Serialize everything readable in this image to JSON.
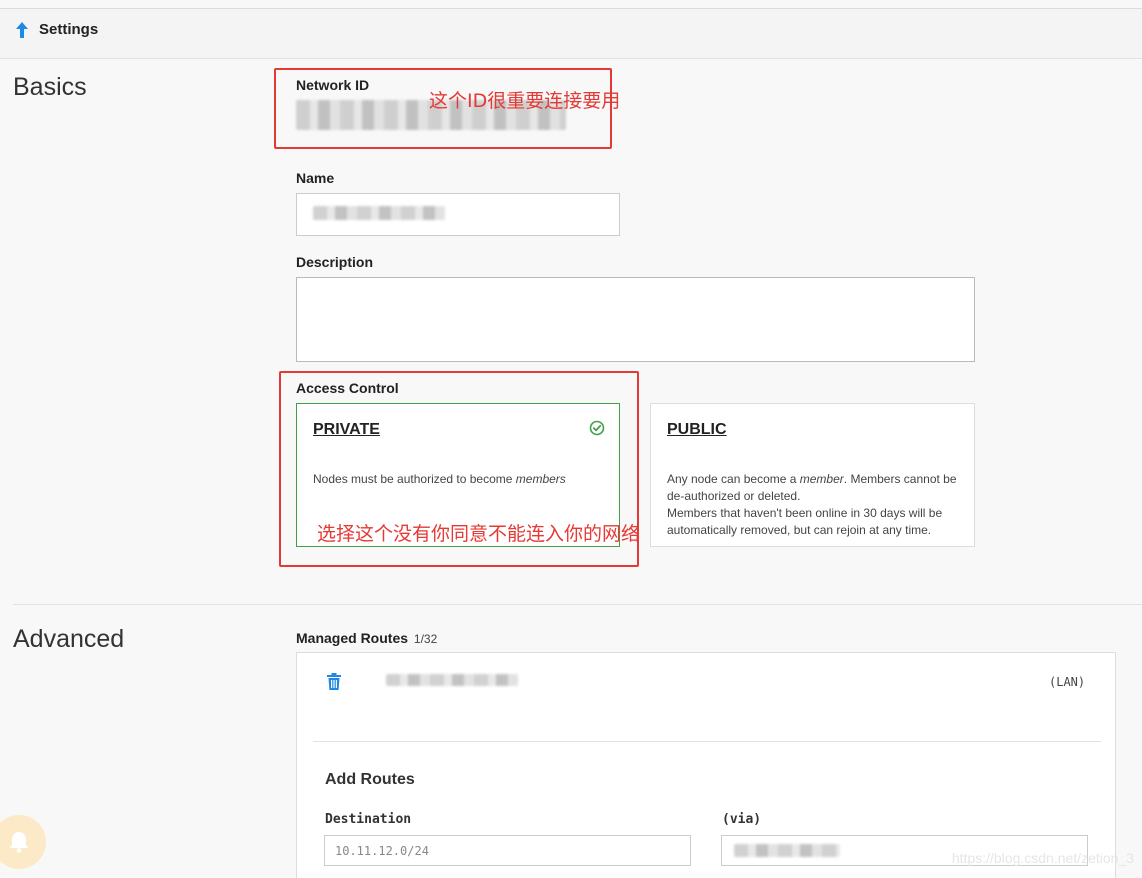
{
  "header": {
    "title": "Settings",
    "icon": "arrow-up-icon"
  },
  "basics": {
    "title": "Basics",
    "network_id_label": "Network ID",
    "name_label": "Name",
    "description_label": "Description",
    "description_value": "",
    "access_control_label": "Access Control",
    "private": {
      "title": "PRIVATE",
      "desc_prefix": "Nodes must be authorized to become ",
      "desc_em": "members",
      "selected": true
    },
    "public": {
      "title": "PUBLIC",
      "line1_prefix": "Any node can become a ",
      "line1_em": "member",
      "line1_suffix": ". Members cannot be",
      "line2": "de-authorized or deleted.",
      "line3": "Members that haven't been online in 30 days will be",
      "line4": "automatically removed, but can rejoin at any time."
    }
  },
  "annotations": {
    "network_id_note": "这个ID很重要连接要用",
    "access_note": "选择这个没有你同意不能连入你的网络"
  },
  "advanced": {
    "title": "Advanced",
    "managed_routes_label": "Managed Routes",
    "managed_routes_count": "1/32",
    "route_tag": "(LAN)",
    "add_routes_title": "Add Routes",
    "destination_label": "Destination",
    "destination_placeholder": "10.11.12.0/24",
    "via_label": "(via)"
  },
  "colors": {
    "accent_blue": "#1e88e5",
    "selected_green": "#43a047",
    "annotation_red": "#e53935"
  },
  "watermark": "https://blog.csdn.net/zetion_3"
}
